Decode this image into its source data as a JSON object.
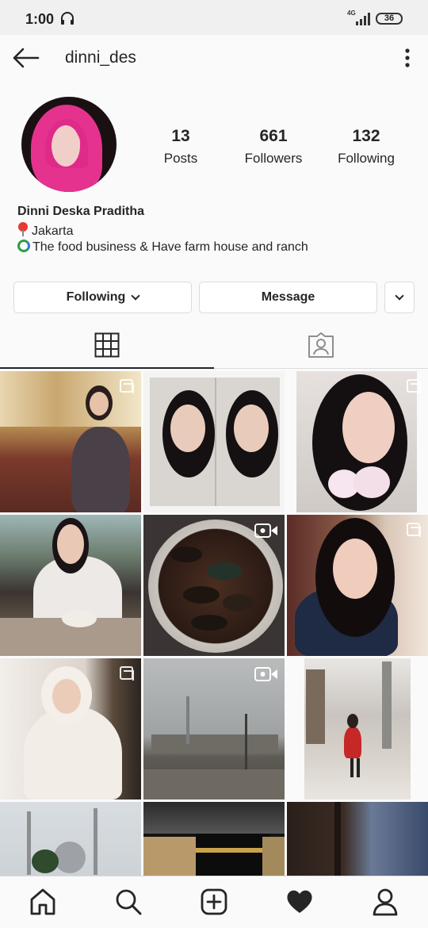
{
  "status_bar": {
    "time": "1:00",
    "network": "4G",
    "battery": "36"
  },
  "header": {
    "username": "dinni_des"
  },
  "profile": {
    "stats": [
      {
        "count": "13",
        "label": "Posts"
      },
      {
        "count": "661",
        "label": "Followers"
      },
      {
        "count": "132",
        "label": "Following"
      }
    ],
    "display_name": "Dinni Deska Praditha",
    "location": "Jakarta",
    "bio": "The food business & Have farm house and ranch"
  },
  "actions": {
    "following_label": "Following",
    "message_label": "Message"
  },
  "tabs": [
    {
      "icon": "grid-icon",
      "active": true
    },
    {
      "icon": "tagged-icon",
      "active": false
    }
  ],
  "posts": [
    {
      "type": "multi",
      "subject": "woman in hotel lobby"
    },
    {
      "type": "single",
      "subject": "two selfie collage"
    },
    {
      "type": "multi",
      "subject": "woman holding skincare jar"
    },
    {
      "type": "single",
      "subject": "woman at restaurant table"
    },
    {
      "type": "video",
      "subject": "bowl of mussels"
    },
    {
      "type": "multi",
      "subject": "woman selfie in blazer"
    },
    {
      "type": "multi",
      "subject": "woman in white prayer garment"
    },
    {
      "type": "video",
      "subject": "foggy city street"
    },
    {
      "type": "single",
      "subject": "woman walking in snow"
    },
    {
      "type": "single",
      "subject": "mosque with minarets"
    },
    {
      "type": "single",
      "subject": "kaaba at night"
    },
    {
      "type": "single",
      "subject": "sky at dusk"
    }
  ],
  "bottom_nav": [
    "home-icon",
    "search-icon",
    "add-post-icon",
    "activity-heart-icon",
    "profile-icon"
  ],
  "colors": {
    "text": "#262626",
    "border": "#dbdbdb",
    "background": "#fafafa"
  }
}
